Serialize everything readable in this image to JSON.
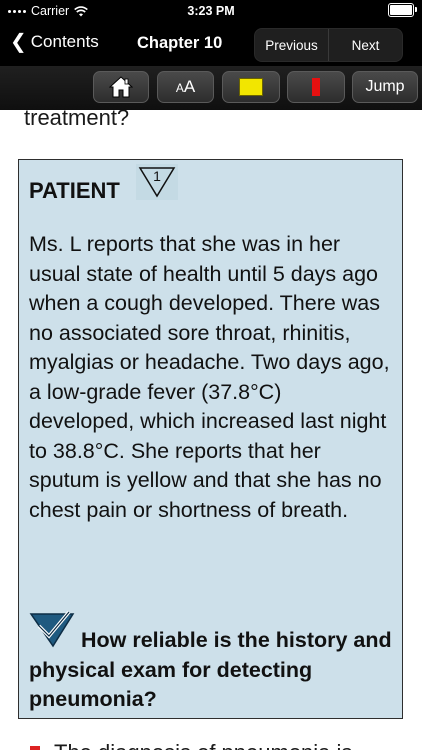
{
  "status_bar": {
    "carrier": "Carrier",
    "time": "3:23 PM"
  },
  "nav": {
    "back_label": "Contents",
    "title": "Chapter 10",
    "segments": [
      "Previous",
      "Next"
    ]
  },
  "toolbar": {
    "font_label_small": "A",
    "font_label_large": "A",
    "jump_label": "Jump",
    "highlight_color": "#f2e600",
    "bookmark_color": "#e61010"
  },
  "content": {
    "previous_line": "treatment?",
    "patient_heading": "PATIENT",
    "badge_number": "1",
    "patient_paragraph": "Ms. L reports that she was in her usual state of health until 5 days ago when a cough developed. There was no associated sore throat, rhinitis, myalgias or headache. Two days ago, a low-grade fever (37.8°C) developed, which increased last night to 38.8°C. She reports that her sputum is yellow and that she has no chest pain or shortness of breath.",
    "question": "How reliable is the history and physical exam for detecting pneumonia?",
    "next_line": "The diagnosis of pneumonia is",
    "box_color": "#cde0ea"
  }
}
